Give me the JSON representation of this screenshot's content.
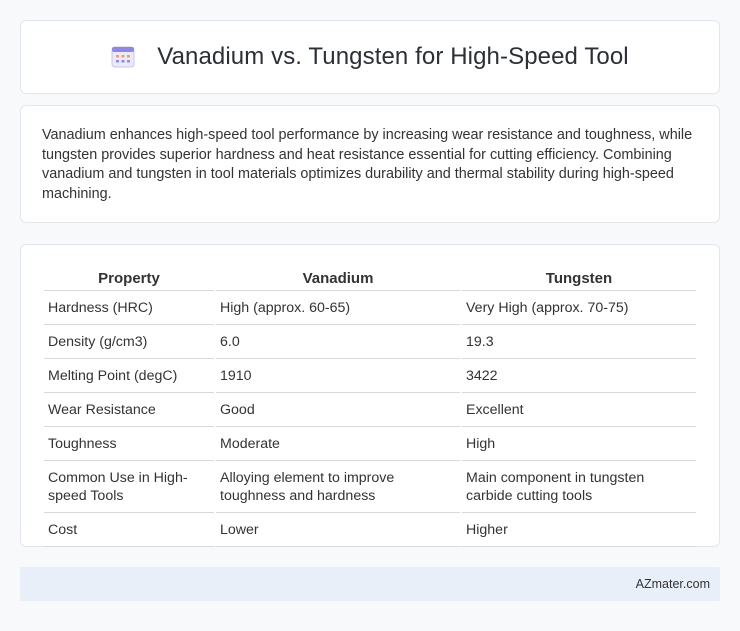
{
  "header": {
    "title": "Vanadium vs. Tungsten for High-Speed Tool",
    "icon": "calendar-icon"
  },
  "intro": {
    "text": "Vanadium enhances high-speed tool performance by increasing wear resistance and toughness, while tungsten provides superior hardness and heat resistance essential for cutting efficiency. Combining vanadium and tungsten in tool materials optimizes durability and thermal stability during high-speed machining."
  },
  "table": {
    "headers": [
      "Property",
      "Vanadium",
      "Tungsten"
    ],
    "rows": [
      [
        "Hardness (HRC)",
        "High (approx. 60-65)",
        "Very High (approx. 70-75)"
      ],
      [
        "Density (g/cm3)",
        "6.0",
        "19.3"
      ],
      [
        "Melting Point (degC)",
        "1910",
        "3422"
      ],
      [
        "Wear Resistance",
        "Good",
        "Excellent"
      ],
      [
        "Toughness",
        "Moderate",
        "High"
      ],
      [
        "Common Use in High-speed Tools",
        "Alloying element to improve toughness and hardness",
        "Main component in tungsten carbide cutting tools"
      ],
      [
        "Cost",
        "Lower",
        "Higher"
      ]
    ]
  },
  "footer": {
    "text": "AZmater.com"
  }
}
